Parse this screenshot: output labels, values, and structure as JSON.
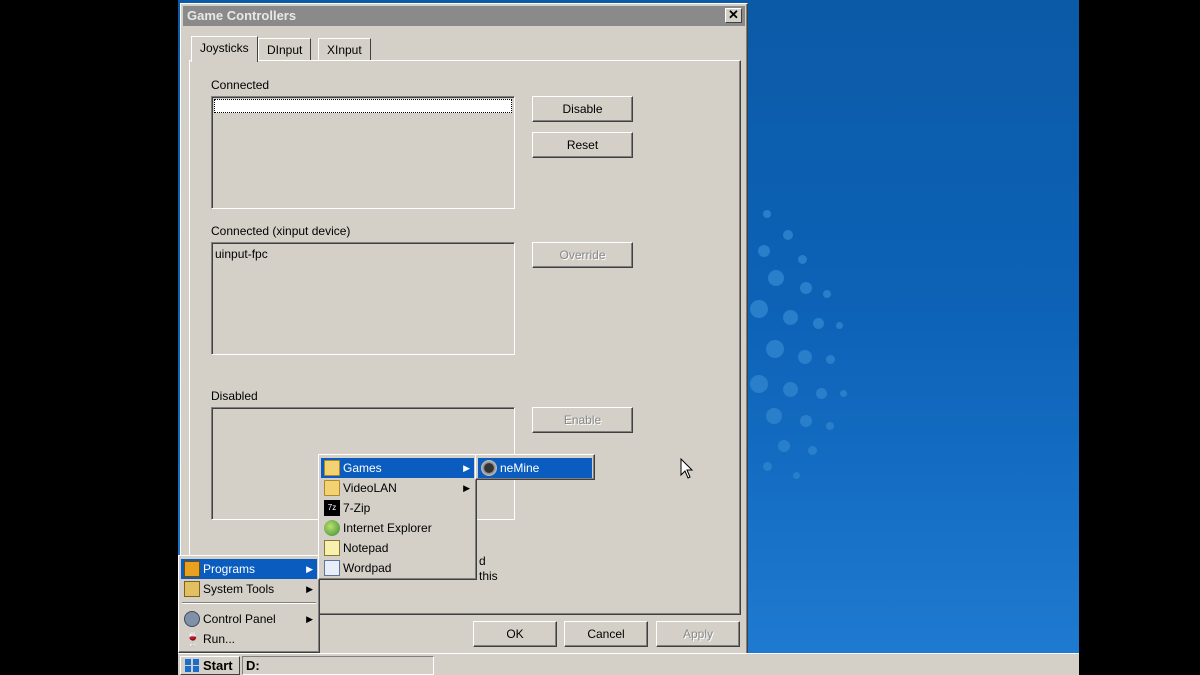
{
  "dialog": {
    "title": "Game Controllers",
    "close_label": "✕",
    "tabs": [
      {
        "label": "Joysticks",
        "active": true
      },
      {
        "label": "DInput",
        "active": false
      },
      {
        "label": "XInput",
        "active": false
      }
    ],
    "connected": {
      "label": "Connected",
      "items": []
    },
    "xinput": {
      "label": "Connected (xinput device)",
      "items": [
        "uinput-fpc"
      ]
    },
    "disabled": {
      "label": "Disabled",
      "items": []
    },
    "buttons": {
      "disable": "Disable",
      "reset": "Reset",
      "override": "Override",
      "enable": "Enable",
      "ok": "OK",
      "cancel": "Cancel",
      "apply": "Apply"
    },
    "partial_text": [
      "d",
      "this"
    ]
  },
  "start_menu": {
    "items": [
      {
        "label": "Programs",
        "icon": "programs-icon",
        "submenu": true,
        "highlighted": true
      },
      {
        "label": "System Tools",
        "icon": "system-tools-icon",
        "submenu": true
      },
      {
        "label": "Control Panel",
        "icon": "control-panel-icon",
        "submenu": true
      },
      {
        "label": "Run...",
        "icon": "run-icon",
        "submenu": false
      }
    ]
  },
  "programs_menu": {
    "items": [
      {
        "label": "Games",
        "icon": "folder-icon",
        "submenu": true,
        "highlighted": true
      },
      {
        "label": "VideoLAN",
        "icon": "folder-icon",
        "submenu": true
      },
      {
        "label": "7-Zip",
        "icon": "7zip-icon"
      },
      {
        "label": "Internet Explorer",
        "icon": "ie-globe-icon"
      },
      {
        "label": "Notepad",
        "icon": "notepad-icon"
      },
      {
        "label": "Wordpad",
        "icon": "wordpad-icon"
      }
    ]
  },
  "games_menu": {
    "items": [
      {
        "label": "neMine",
        "icon": "minesweeper-icon",
        "highlighted": true
      }
    ]
  },
  "taskbar": {
    "start_label": "Start",
    "drive_label": "D:"
  },
  "colors": {
    "highlight": "#0a5cbf",
    "desktop": "#1363b3",
    "face": "#d4d0c8"
  }
}
